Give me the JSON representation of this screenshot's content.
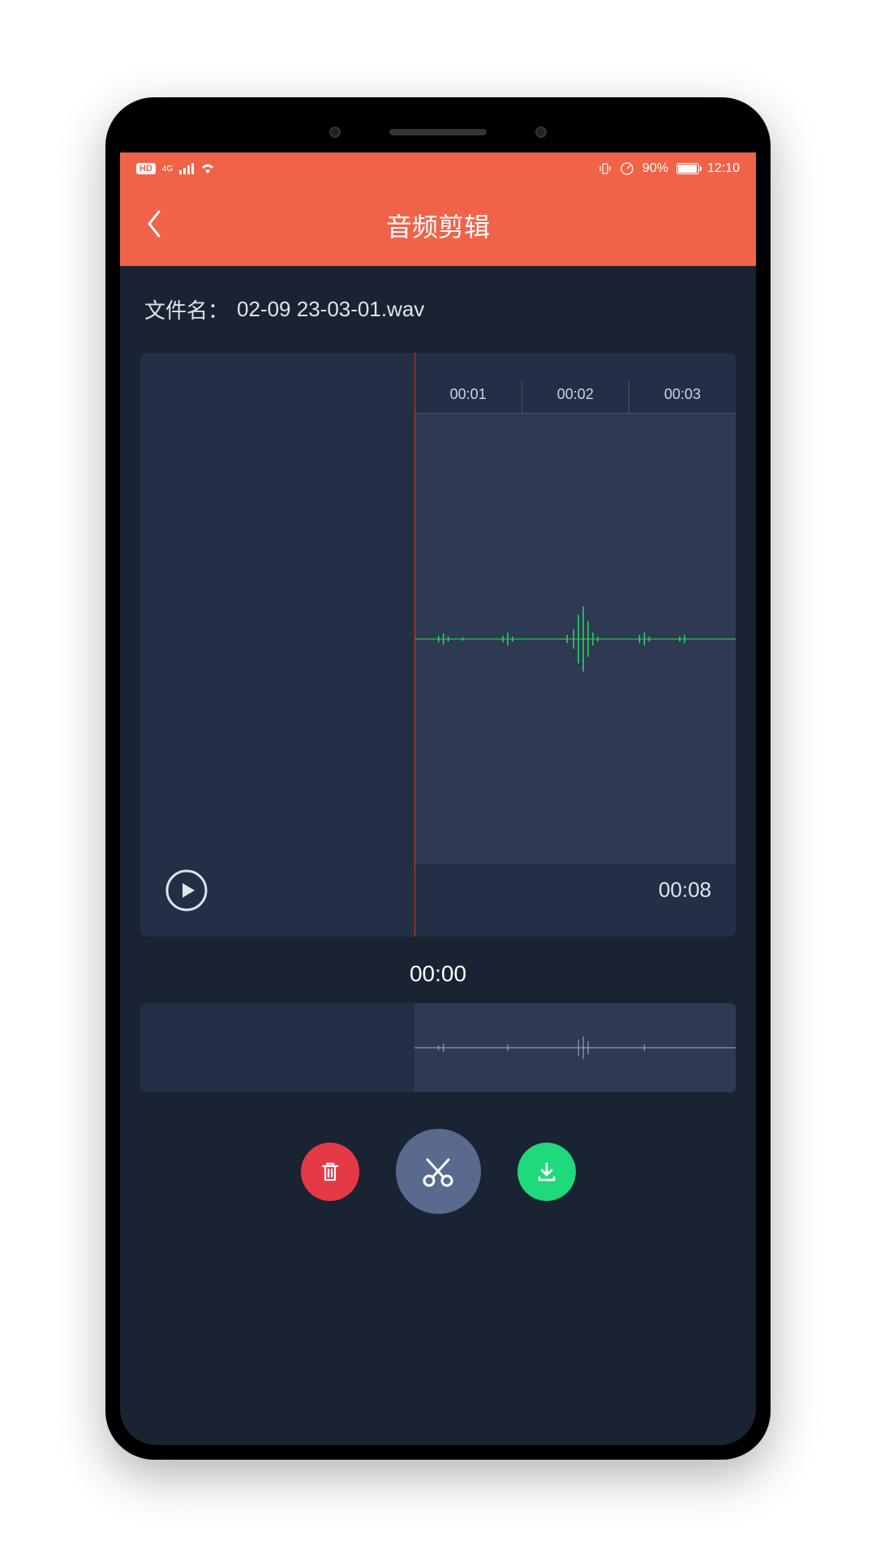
{
  "status_bar": {
    "hd_label": "HD",
    "network_label": "4G",
    "battery_percent": "90%",
    "time": "12:10"
  },
  "header": {
    "title": "音频剪辑"
  },
  "file": {
    "label": "文件名：",
    "name": "02-09 23-03-01.wav"
  },
  "timeline": {
    "ticks": [
      "00:01",
      "00:02",
      "00:03"
    ],
    "duration": "00:08",
    "current_time": "00:00"
  },
  "colors": {
    "accent": "#f06348",
    "bg_dark": "#1a2332",
    "panel": "#232f45",
    "waveform": "#2dd95f",
    "delete": "#e63946",
    "cut": "#5a6a8f",
    "save": "#20d97a"
  }
}
